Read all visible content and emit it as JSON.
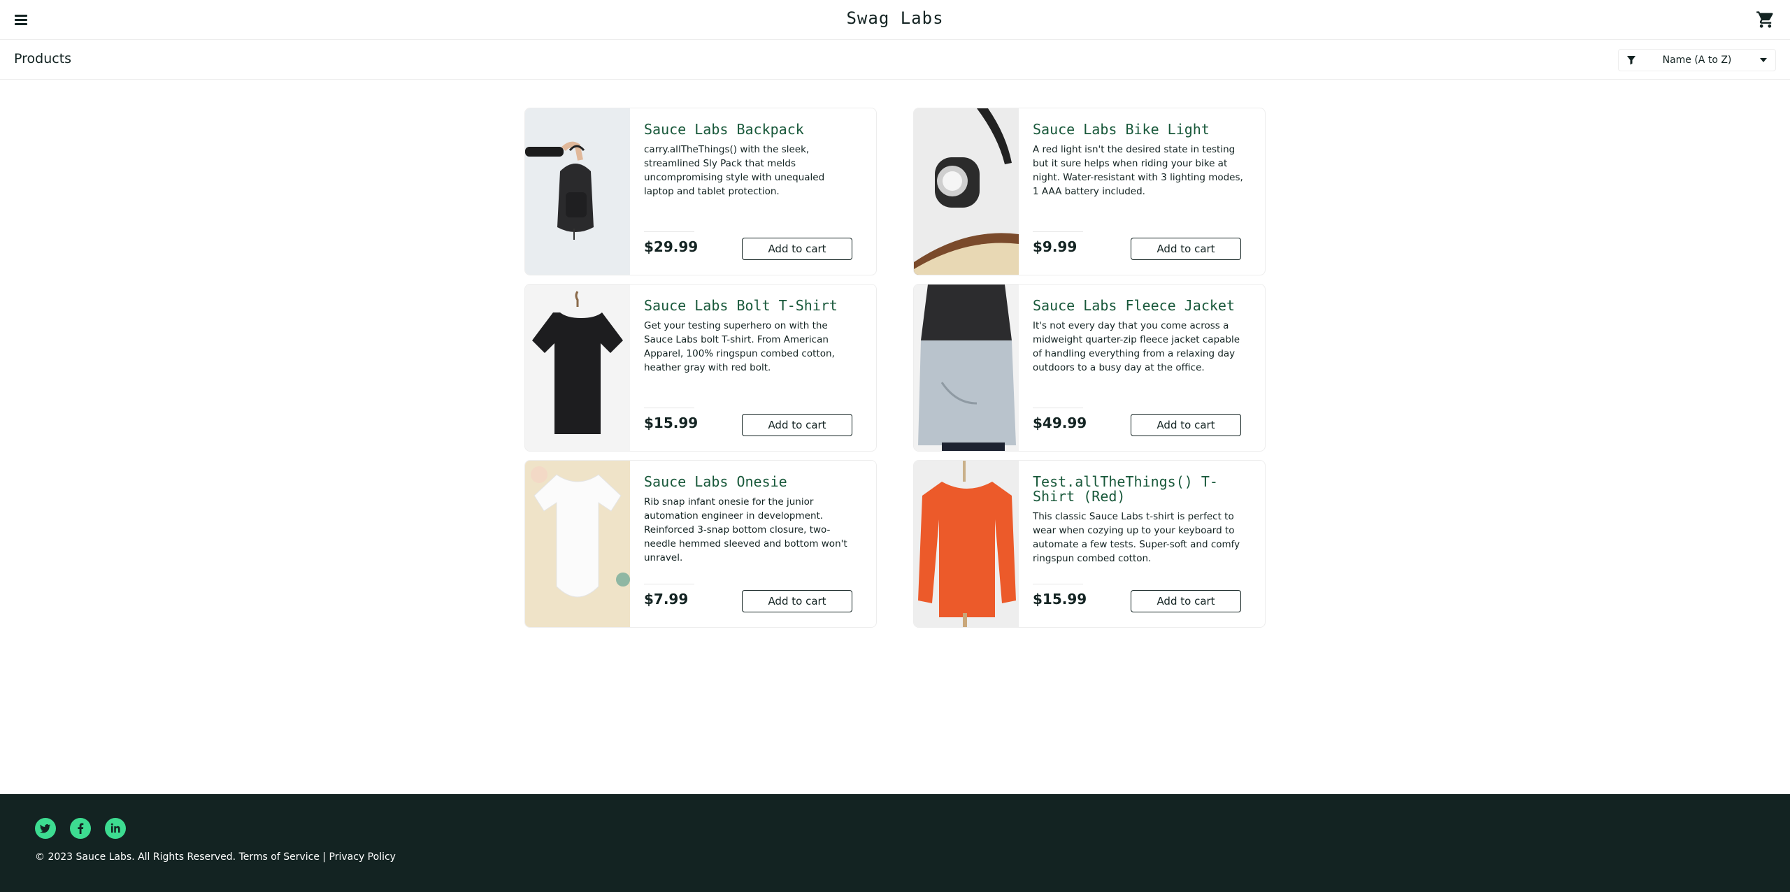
{
  "header": {
    "app_title": "Swag Labs",
    "menu_icon": "hamburger-menu-icon",
    "cart_icon": "shopping-cart-icon"
  },
  "subheader": {
    "title": "Products",
    "sort": {
      "icon": "filter-icon",
      "selected": "Name (A to Z)"
    }
  },
  "products": [
    {
      "name": "Sauce Labs Backpack",
      "description": "carry.allTheThings() with the sleek, streamlined Sly Pack that melds uncompromising style with unequaled laptop and tablet protection.",
      "price": "$29.99",
      "button": "Add to cart"
    },
    {
      "name": "Sauce Labs Bike Light",
      "description": "A red light isn't the desired state in testing but it sure helps when riding your bike at night. Water-resistant with 3 lighting modes, 1 AAA battery included.",
      "price": "$9.99",
      "button": "Add to cart"
    },
    {
      "name": "Sauce Labs Bolt T-Shirt",
      "description": "Get your testing superhero on with the Sauce Labs bolt T-shirt. From American Apparel, 100% ringspun combed cotton, heather gray with red bolt.",
      "price": "$15.99",
      "button": "Add to cart"
    },
    {
      "name": "Sauce Labs Fleece Jacket",
      "description": "It's not every day that you come across a midweight quarter-zip fleece jacket capable of handling everything from a relaxing day outdoors to a busy day at the office.",
      "price": "$49.99",
      "button": "Add to cart"
    },
    {
      "name": "Sauce Labs Onesie",
      "description": "Rib snap infant onesie for the junior automation engineer in development. Reinforced 3-snap bottom closure, two-needle hemmed sleeved and bottom won't unravel.",
      "price": "$7.99",
      "button": "Add to cart"
    },
    {
      "name": "Test.allTheThings() T-Shirt (Red)",
      "description": "This classic Sauce Labs t-shirt is perfect to wear when cozying up to your keyboard to automate a few tests. Super-soft and comfy ringspun combed cotton.",
      "price": "$15.99",
      "button": "Add to cart"
    }
  ],
  "footer": {
    "social": [
      "twitter-icon",
      "facebook-icon",
      "linkedin-icon"
    ],
    "copyright": "© 2023 Sauce Labs. All Rights Reserved. Terms of Service | Privacy Policy"
  },
  "colors": {
    "accent": "#18583a",
    "footer_bg": "#132322",
    "social": "#3ddc91"
  }
}
